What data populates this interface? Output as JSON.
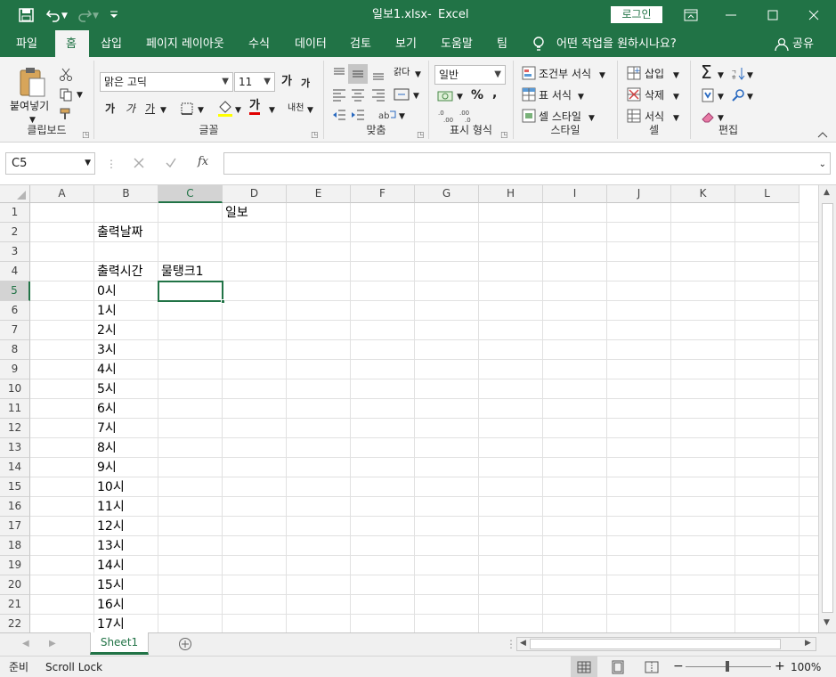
{
  "title": {
    "file": "일보1.xlsx",
    "sep": "-",
    "app": "Excel",
    "login": "로그인"
  },
  "tabs": [
    {
      "label": "파일"
    },
    {
      "label": "홈",
      "active": true
    },
    {
      "label": "삽입"
    },
    {
      "label": "페이지 레이아웃"
    },
    {
      "label": "수식"
    },
    {
      "label": "데이터"
    },
    {
      "label": "검토"
    },
    {
      "label": "보기"
    },
    {
      "label": "도움말"
    },
    {
      "label": "팀"
    }
  ],
  "tellme": "어떤 작업을 원하시나요?",
  "share": "공유",
  "ribbon": {
    "clipboard": {
      "paste": "붙여넣기",
      "label": "클립보드"
    },
    "font": {
      "name": "맑은 고딕",
      "size": "11",
      "grow": "가",
      "shrink": "가",
      "bold": "가",
      "italic": "가",
      "underline": "가",
      "fontcolor": "가",
      "phonetic": "내천",
      "label": "글꼴"
    },
    "align": {
      "wrap": "갉다",
      "label": "맞춤"
    },
    "number": {
      "format": "일반",
      "percent": "%",
      "comma": ",",
      "label": "표시 형식"
    },
    "styles": {
      "conditional": "조건부 서식",
      "table": "표 서식",
      "cell": "셀 스타일",
      "label": "스타일"
    },
    "cells": {
      "insert": "삽입",
      "delete": "삭제",
      "format": "서식",
      "label": "셀"
    },
    "edit": {
      "label": "편집"
    }
  },
  "formula": {
    "namebox": "C5",
    "fx": "fx",
    "value": ""
  },
  "columns": [
    "A",
    "B",
    "C",
    "D",
    "E",
    "F",
    "G",
    "H",
    "I",
    "J",
    "K",
    "L"
  ],
  "rows": [
    "1",
    "2",
    "3",
    "4",
    "5",
    "6",
    "7",
    "8",
    "9",
    "10",
    "11",
    "12",
    "13",
    "14",
    "15",
    "16",
    "17",
    "18",
    "19",
    "20",
    "21",
    "22"
  ],
  "cells": {
    "D1": "일보",
    "B2": "출력날짜",
    "B4": "출력시간",
    "C4": "물탱크1",
    "B5": "0시",
    "B6": "1시",
    "B7": "2시",
    "B8": "3시",
    "B9": "4시",
    "B10": "5시",
    "B11": "6시",
    "B12": "7시",
    "B13": "8시",
    "B14": "9시",
    "B15": "10시",
    "B16": "11시",
    "B17": "12시",
    "B18": "13시",
    "B19": "14시",
    "B20": "15시",
    "B21": "16시",
    "B22": "17시"
  },
  "selected": "C5",
  "sheet": {
    "name": "Sheet1"
  },
  "status": {
    "ready": "준비",
    "scroll": "Scroll Lock",
    "zoom": "100%"
  },
  "colors": {
    "accent": "#217346",
    "select": "#217346"
  }
}
